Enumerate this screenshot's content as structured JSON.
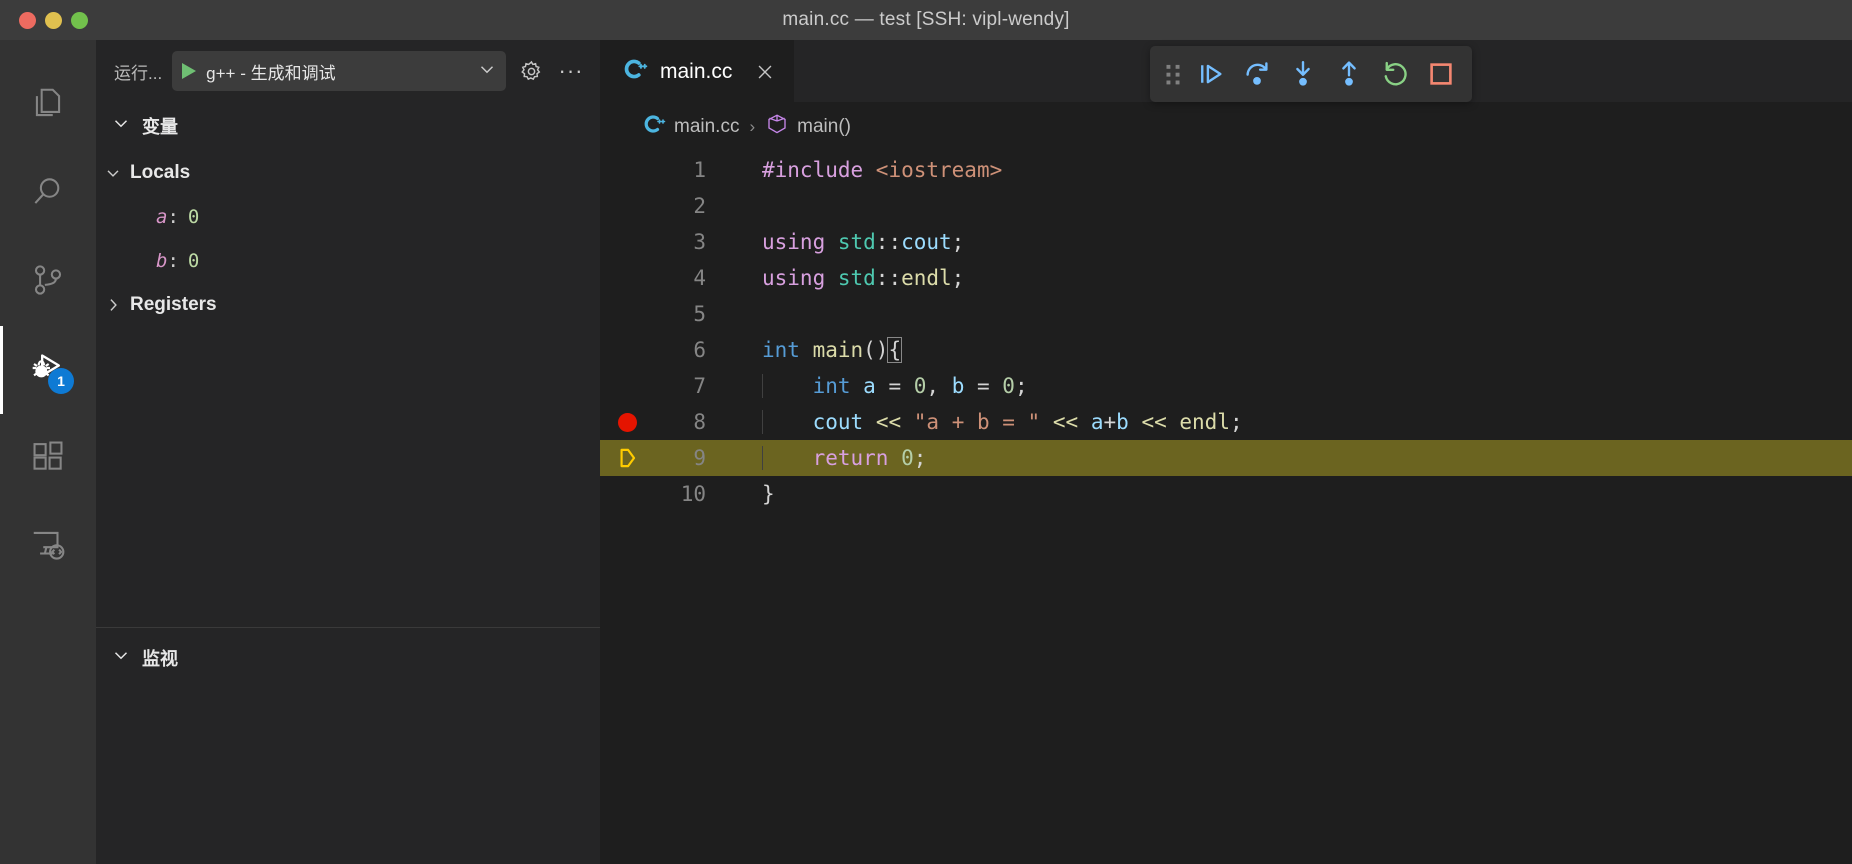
{
  "window": {
    "title": "main.cc — test [SSH: vipl-wendy]",
    "traffic_lights": [
      "close",
      "minimize",
      "maximize"
    ],
    "colors": {
      "titlebar_bg": "#3c3c3c",
      "editor_bg": "#1e1e1e",
      "sidebar_bg": "#252526",
      "accent_blue": "#0e7ad4"
    }
  },
  "activity_bar": {
    "items": [
      {
        "name": "explorer",
        "icon": "files-icon",
        "active": false
      },
      {
        "name": "search",
        "icon": "search-icon",
        "active": false
      },
      {
        "name": "source-control",
        "icon": "source-control-icon",
        "active": false
      },
      {
        "name": "run-and-debug",
        "icon": "run-debug-icon",
        "active": true,
        "badge": "1"
      },
      {
        "name": "extensions",
        "icon": "extensions-icon",
        "active": false
      },
      {
        "name": "remote-explorer",
        "icon": "remote-explorer-icon",
        "active": false
      }
    ],
    "badge_value": "1"
  },
  "sidebar": {
    "header": {
      "title": "运行...",
      "launch_config": "g++ - 生成和调试",
      "start_icon": "play-icon",
      "settings_icon": "gear-icon",
      "more_icon": "more-actions-icon"
    },
    "variables": {
      "section_label": "变量",
      "expanded": true,
      "scopes": [
        {
          "label": "Locals",
          "expanded": true,
          "variables": [
            {
              "name": "a",
              "separator": ":",
              "value": "0"
            },
            {
              "name": "b",
              "separator": ":",
              "value": "0"
            }
          ]
        },
        {
          "label": "Registers",
          "expanded": false,
          "variables": []
        }
      ]
    },
    "watch": {
      "section_label": "监视",
      "expanded": true,
      "items": []
    }
  },
  "editor": {
    "tab": {
      "label": "main.cc",
      "icon": "cpp-file-icon",
      "close_icon": "close-icon",
      "active": true
    },
    "breadcrumb": [
      {
        "label": "main.cc",
        "icon": "cpp-file-icon"
      },
      {
        "label": "main()",
        "icon": "symbol-method-icon"
      }
    ],
    "breadcrumb_separator": "›",
    "lines": [
      {
        "number": "1",
        "tokens": [
          {
            "t": "#include ",
            "c": "t-pre"
          },
          {
            "t": "<iostream>",
            "c": "t-str"
          }
        ]
      },
      {
        "number": "2",
        "tokens": []
      },
      {
        "number": "3",
        "tokens": [
          {
            "t": "using ",
            "c": "t-kw"
          },
          {
            "t": "std",
            "c": "t-ns"
          },
          {
            "t": "::",
            "c": "t-op"
          },
          {
            "t": "cout",
            "c": "t-var"
          },
          {
            "t": ";",
            "c": "t-op"
          }
        ]
      },
      {
        "number": "4",
        "tokens": [
          {
            "t": "using ",
            "c": "t-kw"
          },
          {
            "t": "std",
            "c": "t-ns"
          },
          {
            "t": "::",
            "c": "t-op"
          },
          {
            "t": "endl",
            "c": "t-punc"
          },
          {
            "t": ";",
            "c": "t-op"
          }
        ]
      },
      {
        "number": "5",
        "tokens": []
      },
      {
        "number": "6",
        "tokens": [
          {
            "t": "int ",
            "c": "t-type"
          },
          {
            "t": "main",
            "c": "t-punc"
          },
          {
            "t": "()",
            "c": "t-op"
          },
          {
            "t": "{",
            "c": "t-op"
          }
        ]
      },
      {
        "number": "7",
        "tokens": [
          {
            "t": "    ",
            "c": "t-plain"
          },
          {
            "t": "int ",
            "c": "t-type"
          },
          {
            "t": "a",
            "c": "t-var"
          },
          {
            "t": " = ",
            "c": "t-op"
          },
          {
            "t": "0",
            "c": "t-num"
          },
          {
            "t": ", ",
            "c": "t-op"
          },
          {
            "t": "b",
            "c": "t-var"
          },
          {
            "t": " = ",
            "c": "t-op"
          },
          {
            "t": "0",
            "c": "t-num"
          },
          {
            "t": ";",
            "c": "t-op"
          }
        ]
      },
      {
        "number": "8",
        "tokens": [
          {
            "t": "    ",
            "c": "t-plain"
          },
          {
            "t": "cout",
            "c": "t-var"
          },
          {
            "t": " ",
            "c": "t-op"
          },
          {
            "t": "<<",
            "c": "t-punc"
          },
          {
            "t": " ",
            "c": "t-op"
          },
          {
            "t": "\"a + b = \"",
            "c": "t-str"
          },
          {
            "t": " ",
            "c": "t-op"
          },
          {
            "t": "<<",
            "c": "t-punc"
          },
          {
            "t": " ",
            "c": "t-op"
          },
          {
            "t": "a",
            "c": "t-var"
          },
          {
            "t": "+",
            "c": "t-op"
          },
          {
            "t": "b",
            "c": "t-var"
          },
          {
            "t": " ",
            "c": "t-op"
          },
          {
            "t": "<<",
            "c": "t-punc"
          },
          {
            "t": " ",
            "c": "t-op"
          },
          {
            "t": "endl",
            "c": "t-punc"
          },
          {
            "t": ";",
            "c": "t-op"
          }
        ]
      },
      {
        "number": "9",
        "tokens": [
          {
            "t": "    ",
            "c": "t-plain"
          },
          {
            "t": "return ",
            "c": "t-kw"
          },
          {
            "t": "0",
            "c": "t-num"
          },
          {
            "t": ";",
            "c": "t-op"
          }
        ]
      },
      {
        "number": "10",
        "tokens": [
          {
            "t": "}",
            "c": "t-op"
          }
        ]
      }
    ],
    "breakpoint_line": "8",
    "current_execution_line": "9",
    "current_line_highlight_color": "#6b6420",
    "breakpoint_color": "#e51400",
    "execution_pointer_color": "#ffcc00"
  },
  "debug_toolbar": {
    "grip_icon": "drag-handle-icon",
    "buttons": [
      {
        "name": "continue",
        "icon": "continue-icon",
        "color": "#75beff"
      },
      {
        "name": "step-over",
        "icon": "step-over-icon",
        "color": "#75beff"
      },
      {
        "name": "step-into",
        "icon": "step-into-icon",
        "color": "#75beff"
      },
      {
        "name": "step-out",
        "icon": "step-out-icon",
        "color": "#75beff"
      },
      {
        "name": "restart",
        "icon": "restart-icon",
        "color": "#89d185"
      },
      {
        "name": "stop",
        "icon": "stop-icon",
        "color": "#f48771"
      }
    ]
  }
}
